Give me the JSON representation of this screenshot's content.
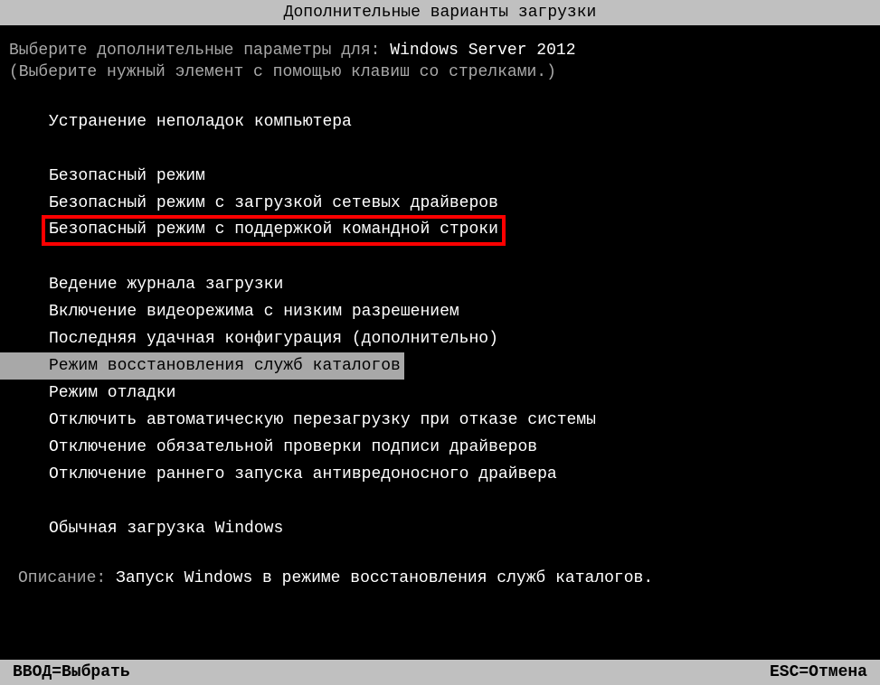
{
  "title": "Дополнительные варианты загрузки",
  "prompt": {
    "prefix": "Выберите дополнительные параметры для: ",
    "os": "Windows Server 2012"
  },
  "instruction": "(Выберите нужный элемент с помощью клавиш со стрелками.)",
  "options": {
    "repair": "Устранение неполадок компьютера",
    "safe_mode": "Безопасный режим",
    "safe_mode_net": "Безопасный режим с загрузкой сетевых драйверов",
    "safe_mode_cmd": "Безопасный режим с поддержкой командной строки",
    "boot_log": "Ведение журнала загрузки",
    "low_res": "Включение видеорежима с низким разрешением",
    "last_known": "Последняя удачная конфигурация (дополнительно)",
    "ds_restore": "Режим восстановления служб каталогов",
    "debug": "Режим отладки",
    "no_auto_restart": "Отключить автоматическую перезагрузку при отказе системы",
    "no_sig_enforce": "Отключение обязательной проверки подписи драйверов",
    "no_early_am": "Отключение раннего запуска антивредоносного драйвера",
    "normal": "Обычная загрузка Windows"
  },
  "description": {
    "label": "Описание: ",
    "text": "Запуск Windows в режиме восстановления служб каталогов."
  },
  "footer": {
    "enter": "ВВОД=Выбрать",
    "esc": "ESC=Отмена"
  }
}
